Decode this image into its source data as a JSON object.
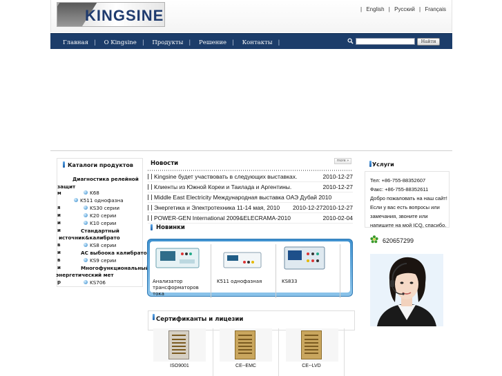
{
  "header": {
    "logo_text": "KINGSINE",
    "languages": [
      "English",
      "Русский",
      "Français"
    ]
  },
  "nav": {
    "items": [
      "Главная",
      "O Kingsine",
      "Продукты",
      "Решение",
      "Контакты"
    ]
  },
  "search": {
    "placeholder": "",
    "button_label": "Найти"
  },
  "catalog": {
    "title": "Каталоги продуктов",
    "items": [
      "Диагностика релейной",
      "защит",
      "K68",
      "K511 однофазна",
      "KS30 серии",
      "K20 серии",
      "K10 серии",
      "Стандартный",
      "источник&калибрато",
      "KS8 серии",
      "AC выбоока калибрато",
      "KS9 серии",
      "Многофункциональный",
      "энергетический мет",
      "KS706"
    ],
    "stray": [
      "м",
      "я",
      "и",
      "и",
      "и",
      "в",
      "и",
      "в",
      "и",
      "р"
    ]
  },
  "news": {
    "title": "Новости",
    "more_label": "more »",
    "items": [
      {
        "title": "Kingsine будет участвовать в следующих выставках.",
        "date": "2010-12-27"
      },
      {
        "title": "Клиенты из Южной Кореи и Таилада и Аргентины.",
        "date": "2010-12-27"
      },
      {
        "title": "Middle East Electricity Международная выставка ОАЭ Дубай 2010",
        "date": ""
      },
      {
        "title": "Энергетика и Электротехника 11-14 мая, 2010",
        "date": "2010-12-272010-12-27"
      },
      {
        "title": "POWER-GEN International 2009&ELECRAMA-2010",
        "date": "2010-02-04"
      }
    ]
  },
  "new_products": {
    "title": "Новинки",
    "items": [
      {
        "label": "Анализатор трансформаторов тока"
      },
      {
        "label": "K511 однофазная"
      },
      {
        "label": "KS833"
      }
    ]
  },
  "certificates": {
    "title": "Сертификанты и лицезии",
    "items": [
      {
        "label": "ISO9001"
      },
      {
        "label": "CE--EMC"
      },
      {
        "label": "CE--LVD"
      }
    ]
  },
  "services": {
    "title": "Услуги",
    "lines": [
      "Тел: +86-755-88352607",
      "Факс: +86-755-88352611",
      "Добро пожаловать на наш сайт! Если у вас есть вопросы или замечания, звоните или напишите на мой ICQ, спасибо."
    ],
    "icq_number": "620657299"
  },
  "colors": {
    "nav_bg": "#1c3d6a",
    "logo_text": "#1f3b6e",
    "accent_blue": "#3f91cf"
  }
}
